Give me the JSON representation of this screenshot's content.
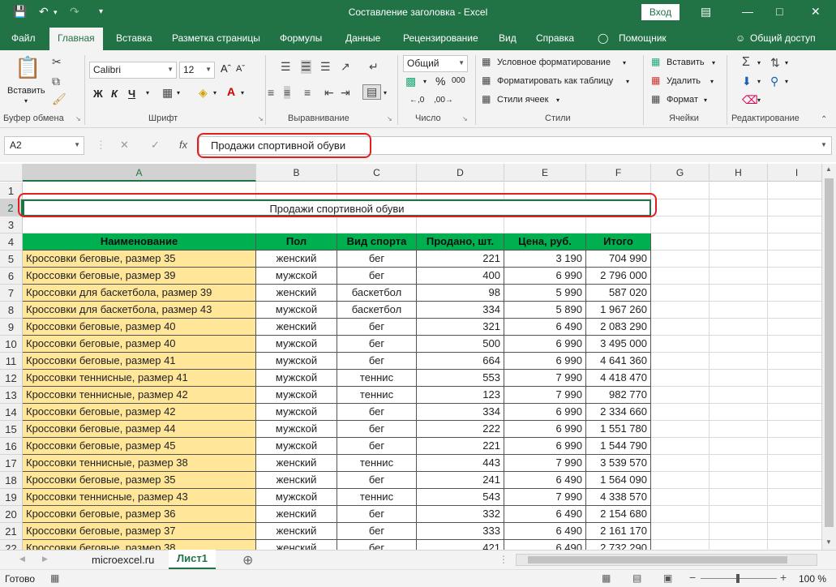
{
  "window": {
    "title": "Составление заголовка - Excel",
    "login": "Вход"
  },
  "tabs": [
    "Файл",
    "Главная",
    "Вставка",
    "Разметка страницы",
    "Формулы",
    "Данные",
    "Рецензирование",
    "Вид",
    "Справка",
    "Помощник",
    "Общий доступ"
  ],
  "ribbon": {
    "paste": "Вставить",
    "font_name": "Calibri",
    "font_size": "12",
    "bold": "Ж",
    "italic": "К",
    "underline": "Ч",
    "number_format": "Общий",
    "pct": "%",
    "thousands": "000",
    "cond_format": "Условное форматирование",
    "format_table": "Форматировать как таблицу",
    "cell_styles": "Стили ячеек",
    "insert": "Вставить",
    "delete": "Удалить",
    "format": "Формат",
    "groups": [
      "Буфер обмена",
      "Шрифт",
      "Выравнивание",
      "Число",
      "Стили",
      "Ячейки",
      "Редактирование"
    ]
  },
  "formula_bar": {
    "name_box": "A2",
    "fx": "fx",
    "formula": "Продажи спортивной обуви"
  },
  "columns": [
    "A",
    "B",
    "C",
    "D",
    "E",
    "F",
    "G",
    "H",
    "I"
  ],
  "rows": [
    "1",
    "2",
    "3",
    "4",
    "5",
    "6",
    "7",
    "8",
    "9",
    "10",
    "11",
    "12",
    "13",
    "14",
    "15",
    "16",
    "17",
    "18",
    "19",
    "20",
    "21",
    "22"
  ],
  "title_cell": "Продажи спортивной обуви",
  "table_header": [
    "Наименование",
    "Пол",
    "Вид спорта",
    "Продано, шт.",
    "Цена, руб.",
    "Итого"
  ],
  "table_rows": [
    [
      "Кроссовки беговые, размер 35",
      "женский",
      "бег",
      "221",
      "3 190",
      "704 990"
    ],
    [
      "Кроссовки беговые, размер 39",
      "мужской",
      "бег",
      "400",
      "6 990",
      "2 796 000"
    ],
    [
      "Кроссовки для баскетбола, размер 39",
      "женский",
      "баскетбол",
      "98",
      "5 990",
      "587 020"
    ],
    [
      "Кроссовки для баскетбола, размер 43",
      "мужской",
      "баскетбол",
      "334",
      "5 890",
      "1 967 260"
    ],
    [
      "Кроссовки беговые, размер 40",
      "женский",
      "бег",
      "321",
      "6 490",
      "2 083 290"
    ],
    [
      "Кроссовки беговые, размер 40",
      "мужской",
      "бег",
      "500",
      "6 990",
      "3 495 000"
    ],
    [
      "Кроссовки беговые, размер 41",
      "мужской",
      "бег",
      "664",
      "6 990",
      "4 641 360"
    ],
    [
      "Кроссовки теннисные, размер 41",
      "мужской",
      "теннис",
      "553",
      "7 990",
      "4 418 470"
    ],
    [
      "Кроссовки теннисные, размер 42",
      "мужской",
      "теннис",
      "123",
      "7 990",
      "982 770"
    ],
    [
      "Кроссовки беговые, размер 42",
      "мужской",
      "бег",
      "334",
      "6 990",
      "2 334 660"
    ],
    [
      "Кроссовки беговые, размер 44",
      "мужской",
      "бег",
      "222",
      "6 990",
      "1 551 780"
    ],
    [
      "Кроссовки беговые, размер 45",
      "мужской",
      "бег",
      "221",
      "6 990",
      "1 544 790"
    ],
    [
      "Кроссовки теннисные, размер 38",
      "женский",
      "теннис",
      "443",
      "7 990",
      "3 539 570"
    ],
    [
      "Кроссовки беговые, размер 35",
      "женский",
      "бег",
      "241",
      "6 490",
      "1 564 090"
    ],
    [
      "Кроссовки теннисные, размер 43",
      "мужской",
      "теннис",
      "543",
      "7 990",
      "4 338 570"
    ],
    [
      "Кроссовки беговые, размер 36",
      "женский",
      "бег",
      "332",
      "6 490",
      "2 154 680"
    ],
    [
      "Кроссовки беговые, размер 37",
      "женский",
      "бег",
      "333",
      "6 490",
      "2 161 170"
    ],
    [
      "Кроссовки беговые, размер 38",
      "женский",
      "бег",
      "421",
      "6 490",
      "2 732 290"
    ]
  ],
  "sheets": [
    "microexcel.ru",
    "Лист1"
  ],
  "status": {
    "ready": "Готово",
    "zoom": "100 %"
  },
  "colors": {
    "accent": "#217346",
    "header_fill": "#00b050",
    "name_fill": "#ffe699",
    "highlight": "#e02020"
  }
}
